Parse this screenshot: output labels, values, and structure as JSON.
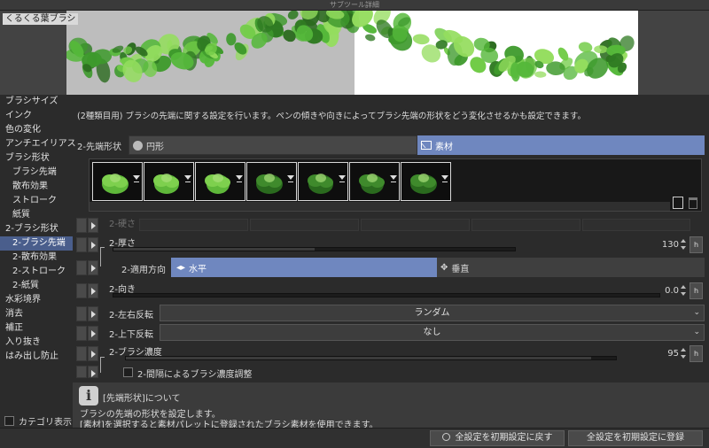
{
  "window": {
    "title": "サブツール詳細"
  },
  "preview": {
    "brush_name": "くるくる葉ブラシ"
  },
  "sidebar": {
    "items": [
      {
        "label": "ブラシサイズ",
        "sub": false,
        "selected": false
      },
      {
        "label": "インク",
        "sub": false,
        "selected": false
      },
      {
        "label": "色の変化",
        "sub": false,
        "selected": false
      },
      {
        "label": "アンチエイリアス",
        "sub": false,
        "selected": false
      },
      {
        "label": "ブラシ形状",
        "sub": false,
        "selected": false
      },
      {
        "label": "ブラシ先端",
        "sub": true,
        "selected": false
      },
      {
        "label": "散布効果",
        "sub": true,
        "selected": false
      },
      {
        "label": "ストローク",
        "sub": true,
        "selected": false
      },
      {
        "label": "紙質",
        "sub": true,
        "selected": false
      },
      {
        "label": "2-ブラシ形状",
        "sub": false,
        "selected": false
      },
      {
        "label": "2-ブラシ先端",
        "sub": true,
        "selected": true
      },
      {
        "label": "2-散布効果",
        "sub": true,
        "selected": false
      },
      {
        "label": "2-ストローク",
        "sub": true,
        "selected": false
      },
      {
        "label": "2-紙質",
        "sub": true,
        "selected": false
      },
      {
        "label": "水彩境界",
        "sub": false,
        "selected": false
      },
      {
        "label": "消去",
        "sub": false,
        "selected": false
      },
      {
        "label": "補正",
        "sub": false,
        "selected": false
      },
      {
        "label": "入り抜き",
        "sub": false,
        "selected": false
      },
      {
        "label": "はみ出し防止",
        "sub": false,
        "selected": false
      }
    ],
    "category_view_label": "カテゴリ表示"
  },
  "main": {
    "description": "(2種類目用) ブラシの先端に関する設定を行います。ペンの傾きや向きによってブラシ先端の形状をどう変化させるかも設定できます。",
    "tip_shape": {
      "label": "2-先端形状",
      "option_circle": "円形",
      "option_material": "素材",
      "selected": "素材"
    },
    "tips_count": 7,
    "hardness": {
      "label": "2-硬さ",
      "enabled": false
    },
    "thickness": {
      "label": "2-厚さ",
      "value": "130",
      "fraction": 0.5
    },
    "apply_direction": {
      "label": "2-適用方向",
      "option_h": "水平",
      "option_v": "垂直",
      "selected": "水平"
    },
    "direction": {
      "label": "2-向き",
      "value": "0.0",
      "fraction": 0.0
    },
    "flip_h": {
      "label": "2-左右反転",
      "value": "ランダム"
    },
    "flip_v": {
      "label": "2-上下反転",
      "value": "なし"
    },
    "density": {
      "label": "2-ブラシ濃度",
      "value": "95",
      "fraction": 0.95
    },
    "spacing_density": {
      "label": "2-間隔によるブラシ濃度調整",
      "checked": false
    },
    "dynamics_label": "h"
  },
  "info": {
    "icon": "i",
    "title": "[先端形状]について",
    "line1": "ブラシの先端の形状を設定します。",
    "line2": "[素材]を選択すると素材パレットに登録されたブラシ素材を使用できます。"
  },
  "footer": {
    "reset_label": "全設定を初期設定に戻す",
    "register_label": "全設定を初期設定に登録"
  },
  "colors": {
    "accent": "#6f87bf",
    "selected_item": "#4a5e8c",
    "leaf_green": "#4aa83a"
  }
}
